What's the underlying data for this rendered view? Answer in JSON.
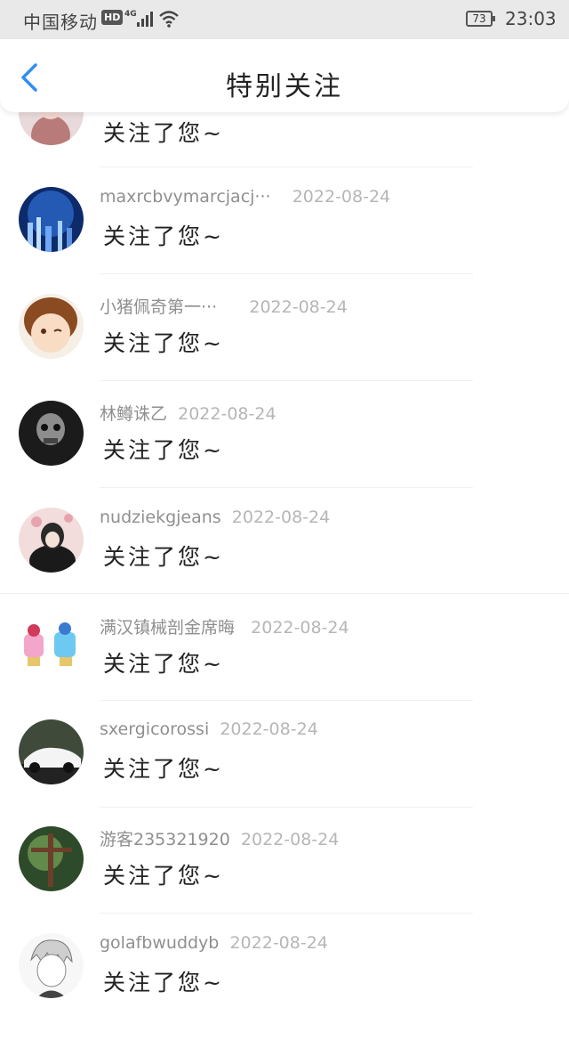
{
  "status_bar": {
    "carrier": "中国移动",
    "hd_badge": "HD",
    "network": "4G",
    "battery": "73",
    "time": "23:03"
  },
  "nav": {
    "title": "特别关注"
  },
  "list": [
    {
      "name": "",
      "date": "",
      "message": "关注了您~"
    },
    {
      "name": "maxrcbvymarcjacj···",
      "date": "2022-08-24",
      "message": "关注了您~"
    },
    {
      "name": "小猪佩奇第一···",
      "date": "2022-08-24",
      "message": "关注了您~"
    },
    {
      "name": "林鳟诛乙",
      "date": "2022-08-24",
      "message": "关注了您~"
    },
    {
      "name": "nudziekgjeans",
      "date": "2022-08-24",
      "message": "关注了您~"
    },
    {
      "name": "满汉镇械剖金席晦",
      "date": "2022-08-24",
      "message": "关注了您~"
    },
    {
      "name": "sxergicorossi",
      "date": "2022-08-24",
      "message": "关注了您~"
    },
    {
      "name": "游客235321920",
      "date": "2022-08-24",
      "message": "关注了您~"
    },
    {
      "name": "golafbwuddyb",
      "date": "2022-08-24",
      "message": "关注了您~"
    }
  ],
  "colors": {
    "accent": "#2f8ef4",
    "status_bar_bg": "#e9e9e9"
  }
}
